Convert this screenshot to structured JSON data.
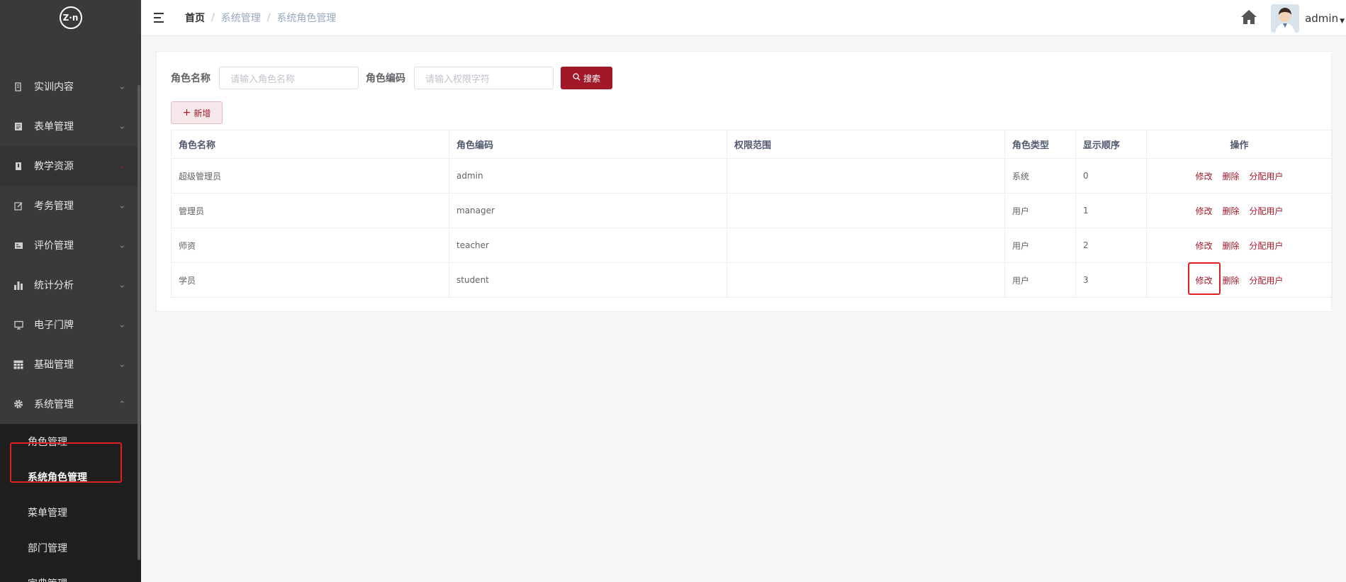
{
  "sidebar": {
    "logo_text": "Z·n",
    "items": [
      {
        "label": "实训内容",
        "icon": "book-icon",
        "expanded": false
      },
      {
        "label": "表单管理",
        "icon": "form-icon",
        "expanded": false
      },
      {
        "label": "教学资源",
        "icon": "resource-icon",
        "expanded": false
      },
      {
        "label": "考务管理",
        "icon": "edit-icon",
        "expanded": false
      },
      {
        "label": "评价管理",
        "icon": "evaluate-icon",
        "expanded": false
      },
      {
        "label": "统计分析",
        "icon": "bar-chart-icon",
        "expanded": false
      },
      {
        "label": "电子门牌",
        "icon": "monitor-icon",
        "expanded": false
      },
      {
        "label": "基础管理",
        "icon": "table-icon",
        "expanded": false
      },
      {
        "label": "系统管理",
        "icon": "gear-icon",
        "expanded": true
      }
    ],
    "submenu": [
      {
        "label": "角色管理",
        "active": false
      },
      {
        "label": "系统角色管理",
        "active": true
      },
      {
        "label": "菜单管理",
        "active": false
      },
      {
        "label": "部门管理",
        "active": false
      },
      {
        "label": "字典管理",
        "active": false
      }
    ]
  },
  "topbar": {
    "breadcrumb": [
      "首页",
      "系统管理",
      "系统角色管理"
    ],
    "username": "admin"
  },
  "search": {
    "role_name_label": "角色名称",
    "role_name_placeholder": "请输入角色名称",
    "role_code_label": "角色编码",
    "role_code_placeholder": "请输入权限字符",
    "search_button": "搜索",
    "add_button": "新增"
  },
  "table": {
    "columns": [
      "角色名称",
      "角色编码",
      "权限范围",
      "角色类型",
      "显示顺序",
      "操作"
    ],
    "rows": [
      {
        "name": "超级管理员",
        "code": "admin",
        "scope": "",
        "type": "系统",
        "order": "0"
      },
      {
        "name": "管理员",
        "code": "manager",
        "scope": "",
        "type": "用户",
        "order": "1"
      },
      {
        "name": "师资",
        "code": "teacher",
        "scope": "",
        "type": "用户",
        "order": "2"
      },
      {
        "name": "学员",
        "code": "student",
        "scope": "",
        "type": "用户",
        "order": "3"
      }
    ],
    "actions": {
      "edit": "修改",
      "delete": "删除",
      "assign": "分配用户"
    }
  },
  "colors": {
    "sidebar_bg": "#3a3a3a",
    "submenu_bg": "#1f1f1f",
    "accent": "#a31829",
    "highlight": "#e02020"
  }
}
